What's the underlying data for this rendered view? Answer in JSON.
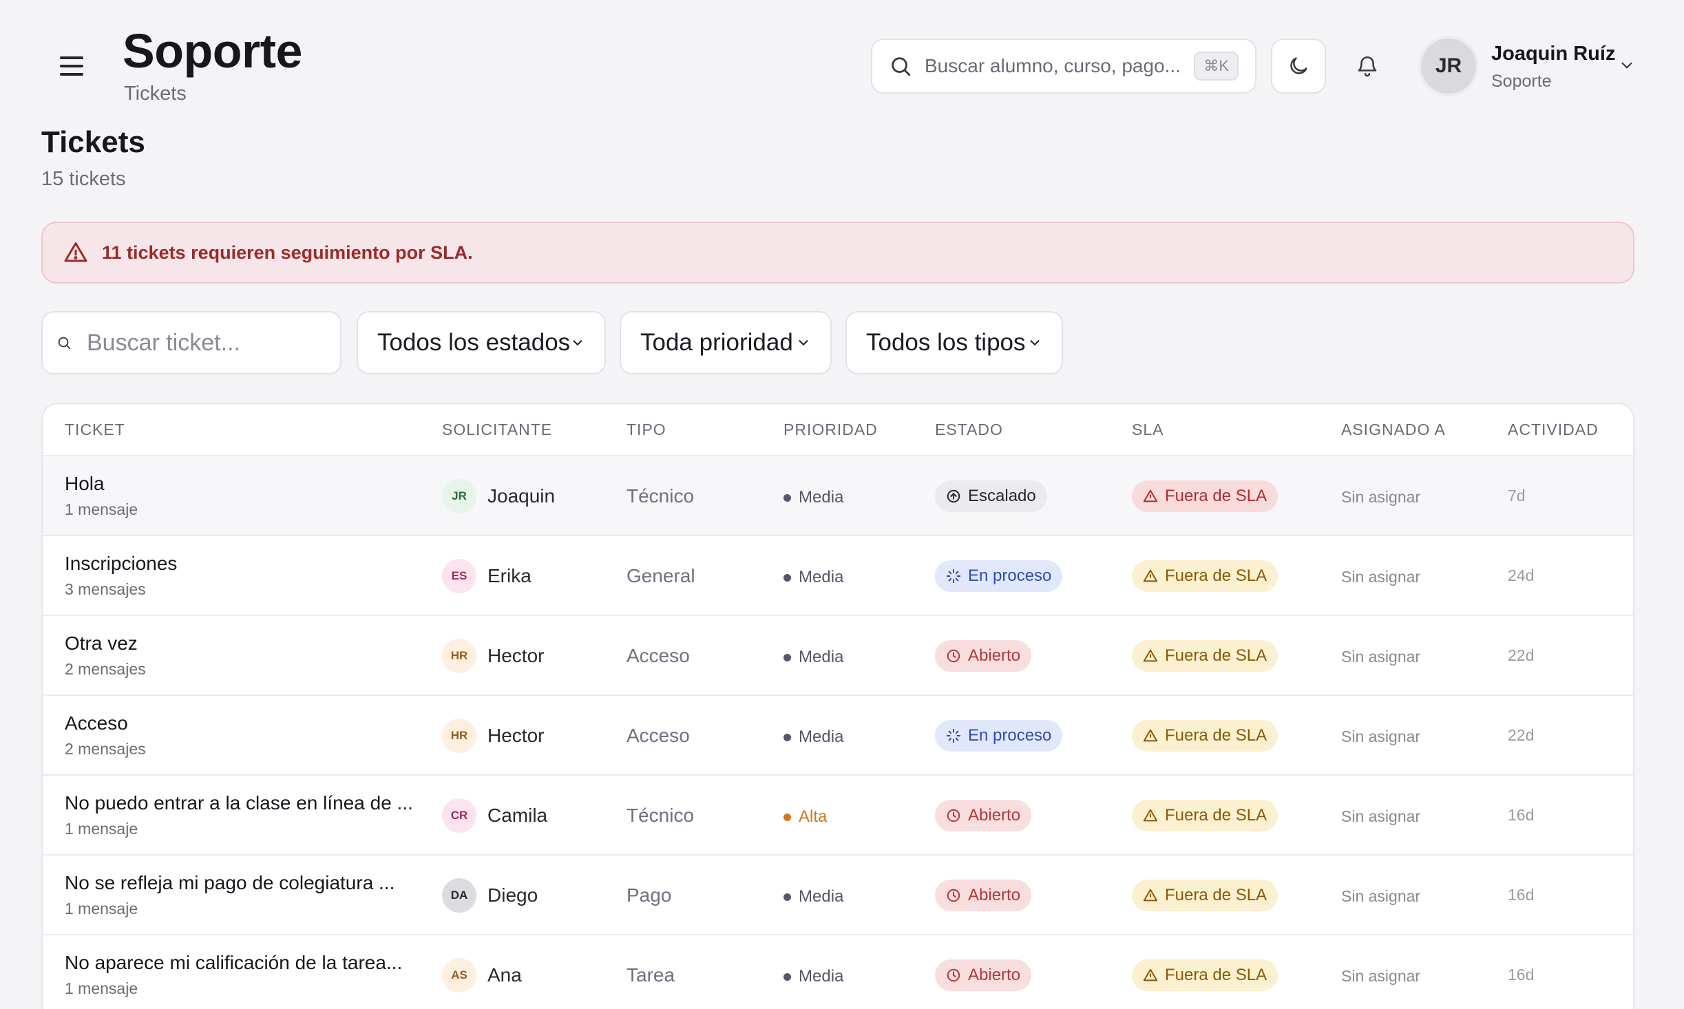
{
  "header": {
    "title": "Soporte",
    "subtitle": "Tickets",
    "search_placeholder": "Buscar alumno, curso, pago...",
    "search_shortcut": "⌘K",
    "user": {
      "initials": "JR",
      "name": "Joaquin Ruíz",
      "role": "Soporte"
    }
  },
  "page": {
    "heading": "Tickets",
    "count_label": "15 tickets"
  },
  "alert": {
    "text": "11 tickets requieren seguimiento por SLA."
  },
  "filters": {
    "search_placeholder": "Buscar ticket...",
    "status_selected": "Todos los estados",
    "priority_selected": "Toda prioridad",
    "type_selected": "Todos los tipos"
  },
  "table": {
    "columns": [
      "TICKET",
      "SOLICITANTE",
      "TIPO",
      "PRIORIDAD",
      "ESTADO",
      "SLA",
      "ASIGNADO A",
      "ACTIVIDAD"
    ],
    "rows": [
      {
        "title": "Hola",
        "messages": "1 mensaje",
        "initials": "JR",
        "requester": "Joaquin",
        "type": "Técnico",
        "priority": "Media",
        "status": "Escalado",
        "sla": "Fuera de SLA",
        "assigned": "Sin asignar",
        "activity": "7d"
      },
      {
        "title": "Inscripciones",
        "messages": "3 mensajes",
        "initials": "ES",
        "requester": "Erika",
        "type": "General",
        "priority": "Media",
        "status": "En proceso",
        "sla": "Fuera de SLA",
        "assigned": "Sin asignar",
        "activity": "24d"
      },
      {
        "title": "Otra vez",
        "messages": "2 mensajes",
        "initials": "HR",
        "requester": "Hector",
        "type": "Acceso",
        "priority": "Media",
        "status": "Abierto",
        "sla": "Fuera de SLA",
        "assigned": "Sin asignar",
        "activity": "22d"
      },
      {
        "title": "Acceso",
        "messages": "2 mensajes",
        "initials": "HR",
        "requester": "Hector",
        "type": "Acceso",
        "priority": "Media",
        "status": "En proceso",
        "sla": "Fuera de SLA",
        "assigned": "Sin asignar",
        "activity": "22d"
      },
      {
        "title": "No puedo entrar a la clase en línea de ...",
        "messages": "1 mensaje",
        "initials": "CR",
        "requester": "Camila",
        "type": "Técnico",
        "priority": "Alta",
        "status": "Abierto",
        "sla": "Fuera de SLA",
        "assigned": "Sin asignar",
        "activity": "16d"
      },
      {
        "title": "No se refleja mi pago de colegiatura ...",
        "messages": "1 mensaje",
        "initials": "DA",
        "requester": "Diego",
        "type": "Pago",
        "priority": "Media",
        "status": "Abierto",
        "sla": "Fuera de SLA",
        "assigned": "Sin asignar",
        "activity": "16d"
      },
      {
        "title": "No aparece mi calificación de la tarea...",
        "messages": "1 mensaje",
        "initials": "AS",
        "requester": "Ana",
        "type": "Tarea",
        "priority": "Media",
        "status": "Abierto",
        "sla": "Fuera de SLA",
        "assigned": "Sin asignar",
        "activity": "16d"
      }
    ]
  },
  "colors": {
    "alert_text": "#9c2a2a",
    "priority_media": "#545868",
    "priority_alta": "#d9731a",
    "sla_red": "#b02d2d",
    "sla_amber": "#8a5a08",
    "status_proceso": "#2f4bb2",
    "status_abierto": "#b03a3a"
  },
  "icons": {
    "menu": "hamburger-menu-icon",
    "search": "search-icon",
    "theme": "moon-icon",
    "notifications": "bell-icon",
    "user_menu": "chevron-down-icon",
    "alert": "warning-triangle-icon",
    "select": "chevron-down-icon",
    "status_escalado": "arrow-up-circle-icon",
    "status_proceso": "loader-icon",
    "status_abierto": "clock-icon",
    "sla": "warning-triangle-icon"
  }
}
